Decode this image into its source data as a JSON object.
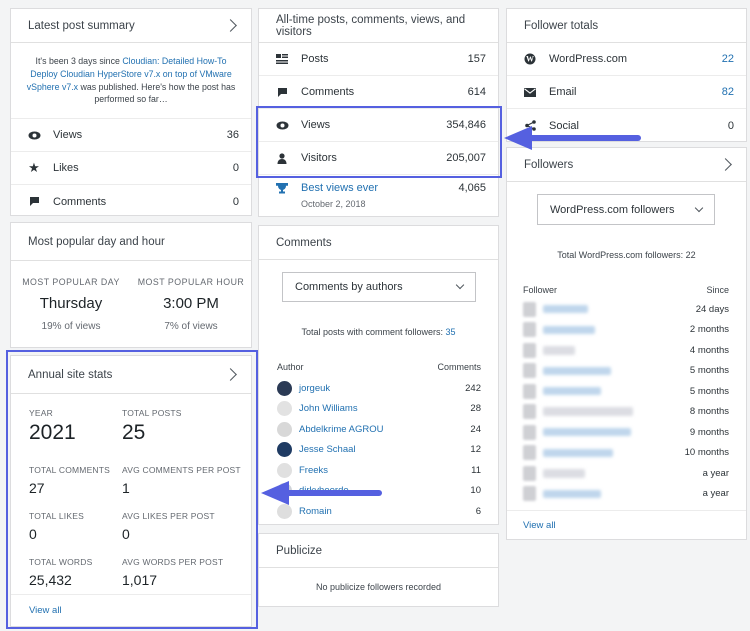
{
  "latest": {
    "title": "Latest post summary",
    "text_pre": "It's been 3 days since ",
    "post_link": "Cloudian: Detailed How-To Deploy Cloudian HyperStore v7.x on top of VMware vSphere v7.x",
    "text_post": " was published. Here's how the post has performed so far…",
    "rows": [
      {
        "icon": "eye-icon",
        "label": "Views",
        "value": "36"
      },
      {
        "icon": "star-icon",
        "label": "Likes",
        "value": "0"
      },
      {
        "icon": "comment-icon",
        "label": "Comments",
        "value": "0"
      }
    ]
  },
  "alltime": {
    "title": "All-time posts, comments, views, and visitors",
    "rows": [
      {
        "icon": "posts-icon",
        "label": "Posts",
        "value": "157"
      },
      {
        "icon": "comment-icon",
        "label": "Comments",
        "value": "614"
      },
      {
        "icon": "eye-icon",
        "label": "Views",
        "value": "354,846"
      },
      {
        "icon": "person-icon",
        "label": "Visitors",
        "value": "205,007"
      }
    ],
    "best_label": "Best views ever",
    "best_date": "October 2, 2018",
    "best_value": "4,065"
  },
  "follower_totals": {
    "title": "Follower totals",
    "rows": [
      {
        "icon": "wordpress-icon",
        "label": "WordPress.com",
        "value": "22"
      },
      {
        "icon": "mail-icon",
        "label": "Email",
        "value": "82"
      },
      {
        "icon": "share-icon",
        "label": "Social",
        "value": "0"
      }
    ]
  },
  "popular": {
    "title": "Most popular day and hour",
    "day_caption": "MOST POPULAR DAY",
    "day": "Thursday",
    "day_pct": "19% of views",
    "hour_caption": "MOST POPULAR HOUR",
    "hour": "3:00 PM",
    "hour_pct": "7% of views"
  },
  "annual": {
    "title": "Annual site stats",
    "year_caption": "YEAR",
    "year": "2021",
    "total_posts_caption": "TOTAL POSTS",
    "total_posts": "25",
    "total_comments_caption": "TOTAL COMMENTS",
    "total_comments": "27",
    "avg_comments_caption": "AVG COMMENTS PER POST",
    "avg_comments": "1",
    "total_likes_caption": "TOTAL LIKES",
    "total_likes": "0",
    "avg_likes_caption": "AVG LIKES PER POST",
    "avg_likes": "0",
    "total_words_caption": "TOTAL WORDS",
    "total_words": "25,432",
    "avg_words_caption": "AVG WORDS PER POST",
    "avg_words": "1,017",
    "view_all": "View all"
  },
  "comments": {
    "title": "Comments",
    "dropdown": "Comments by authors",
    "total_label": "Total posts with comment followers: ",
    "total_value": "35",
    "col_author": "Author",
    "col_comments": "Comments",
    "authors": [
      {
        "name": "jorgeuk",
        "count": "242"
      },
      {
        "name": "John Williams",
        "count": "28"
      },
      {
        "name": "Abdelkrime AGROU",
        "count": "24"
      },
      {
        "name": "Jesse Schaal",
        "count": "12"
      },
      {
        "name": "Freeks",
        "count": "11"
      },
      {
        "name": "dirkvheerde",
        "count": "10"
      },
      {
        "name": "Romain",
        "count": "6"
      }
    ]
  },
  "publicize": {
    "title": "Publicize",
    "empty": "No publicize followers recorded"
  },
  "followers": {
    "title": "Followers",
    "dropdown": "WordPress.com followers",
    "total": "Total WordPress.com followers: 22",
    "col_follower": "Follower",
    "col_since": "Since",
    "since": [
      "24 days",
      "2 months",
      "4 months",
      "5 months",
      "5 months",
      "8 months",
      "9 months",
      "10 months",
      "a year",
      "a year"
    ],
    "view_all": "View all"
  }
}
